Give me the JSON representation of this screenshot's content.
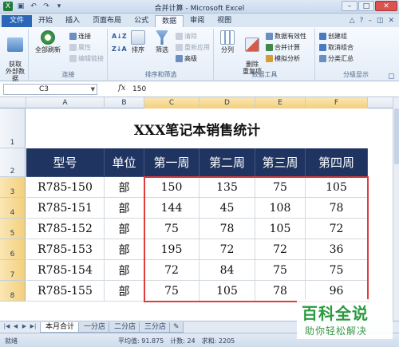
{
  "window": {
    "title": "合并计算 - Microsoft Excel"
  },
  "tabs": {
    "file": "文件",
    "items": [
      "开始",
      "插入",
      "页面布局",
      "公式",
      "数据",
      "审阅",
      "视图"
    ],
    "active": "数据"
  },
  "ribbon": {
    "get_external": "获取\n外部数据",
    "refresh_all": "全部刷新",
    "connections": "连接",
    "properties": "属性",
    "edit_links": "编辑链接",
    "group_connections": "连接",
    "sort": "排序",
    "filter": "筛选",
    "clear": "清除",
    "reapply": "重新应用",
    "advanced": "高级",
    "group_sort_filter": "排序和筛选",
    "split": "分列",
    "remove_dup": "删除\n重复项",
    "validation": "数据有效性",
    "consolidate": "合并计算",
    "what_if": "模拟分析",
    "group_data_tools": "数据工具",
    "group": "创建组",
    "ungroup": "取消组合",
    "subtotal": "分类汇总",
    "group_outline": "分级显示"
  },
  "formula_bar": {
    "name_box": "C3",
    "fx": "fx",
    "value": "150"
  },
  "columns": [
    "A",
    "B",
    "C",
    "D",
    "E",
    "F"
  ],
  "rows": [
    "1",
    "2",
    "3",
    "4",
    "5",
    "6",
    "7",
    "8"
  ],
  "sheet": {
    "title": "XXX笔记本销售统计",
    "headers": [
      "型号",
      "单位",
      "第一周",
      "第二周",
      "第三周",
      "第四周"
    ],
    "data": [
      [
        "R785-150",
        "部",
        "150",
        "135",
        "75",
        "105"
      ],
      [
        "R785-151",
        "部",
        "144",
        "45",
        "108",
        "78"
      ],
      [
        "R785-152",
        "部",
        "75",
        "78",
        "105",
        "72"
      ],
      [
        "R785-153",
        "部",
        "195",
        "72",
        "72",
        "36"
      ],
      [
        "R785-154",
        "部",
        "72",
        "84",
        "75",
        "75"
      ],
      [
        "R785-155",
        "部",
        "75",
        "105",
        "78",
        "96"
      ]
    ]
  },
  "sheet_tabs": [
    "本月合计",
    "一分店",
    "二分店",
    "三分店"
  ],
  "status": {
    "ready": "就绪",
    "average": "平均值: 91.875",
    "count": "计数: 24",
    "sum": "求和: 2205"
  },
  "watermark": {
    "big": "百科全说",
    "small": "助你轻松解决"
  },
  "colors": {
    "header_bg": "#1f3461",
    "selection_border": "#e03c3c",
    "file_tab": "#2a67b6",
    "watermark": "#2b9a3f"
  }
}
